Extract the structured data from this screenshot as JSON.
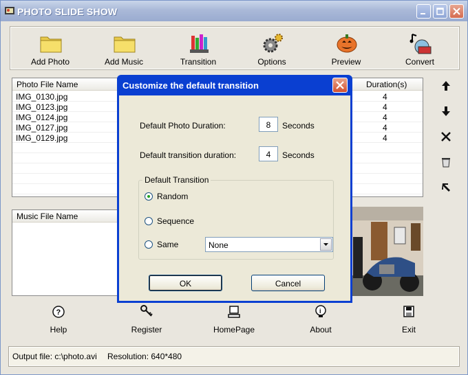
{
  "window": {
    "title": "PHOTO SLIDE SHOW"
  },
  "toolbar": {
    "items": [
      {
        "label": "Add Photo",
        "icon": "folder-icon"
      },
      {
        "label": "Add Music",
        "icon": "folder-icon"
      },
      {
        "label": "Transition",
        "icon": "pencils-icon"
      },
      {
        "label": "Options",
        "icon": "gears-icon"
      },
      {
        "label": "Preview",
        "icon": "pumpkin-icon"
      },
      {
        "label": "Convert",
        "icon": "film-icon"
      }
    ]
  },
  "photo_list": {
    "headers": {
      "name": "Photo File Name",
      "duration": "Duration(s)"
    },
    "rows": [
      {
        "name": "IMG_0130.jpg",
        "duration": "4"
      },
      {
        "name": "IMG_0123.jpg",
        "duration": "4"
      },
      {
        "name": "IMG_0124.jpg",
        "duration": "4"
      },
      {
        "name": "IMG_0127.jpg",
        "duration": "4"
      },
      {
        "name": "IMG_0129.jpg",
        "duration": "4"
      }
    ]
  },
  "music_list": {
    "headers": {
      "name": "Music File Name"
    }
  },
  "side_buttons": [
    "arrow-up-icon",
    "arrow-down-icon",
    "delete-icon",
    "clear-icon",
    "move-top-icon"
  ],
  "bottom": {
    "items": [
      {
        "label": "Help",
        "icon": "help-icon"
      },
      {
        "label": "Register",
        "icon": "key-icon"
      },
      {
        "label": "HomePage",
        "icon": "computer-icon"
      },
      {
        "label": "About",
        "icon": "bulb-icon"
      },
      {
        "label": "Exit",
        "icon": "disk-icon"
      }
    ]
  },
  "status": {
    "output": "Output file: c:\\photo.avi",
    "resolution": "Resolution: 640*480"
  },
  "dialog": {
    "title": "Customize the default transition",
    "photo_duration_label": "Default Photo Duration:",
    "photo_duration_value": "8",
    "photo_duration_unit": "Seconds",
    "transition_duration_label": "Default transition duration:",
    "transition_duration_value": "4",
    "transition_duration_unit": "Seconds",
    "group_title": "Default Transition",
    "options": [
      {
        "label": "Random",
        "selected": true
      },
      {
        "label": "Sequence",
        "selected": false
      },
      {
        "label": "Same",
        "selected": false
      }
    ],
    "same_select_value": "None",
    "ok_label": "OK",
    "cancel_label": "Cancel"
  },
  "colors": {
    "titlebar": "#9aabd0",
    "dialog_title": "#0a3fd1",
    "close_button": "#d2502f",
    "radio_selected": "#21a121"
  }
}
